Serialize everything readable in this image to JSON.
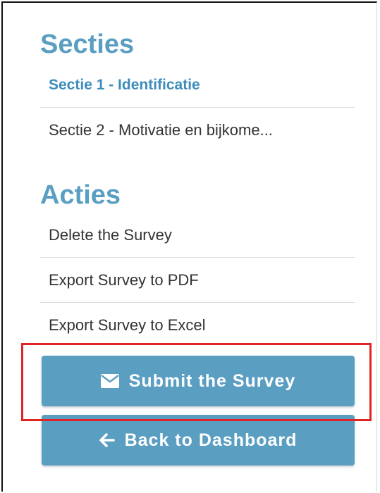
{
  "sections": {
    "heading": "Secties",
    "items": [
      {
        "label": "Sectie 1 - Identificatie",
        "active": true
      },
      {
        "label": "Sectie 2 - Motivatie en bijkome...",
        "active": false
      }
    ]
  },
  "actions": {
    "heading": "Acties",
    "items": [
      {
        "label": "Delete the Survey"
      },
      {
        "label": "Export Survey to PDF"
      },
      {
        "label": "Export Survey to Excel"
      }
    ]
  },
  "buttons": {
    "submit_label": "Submit the Survey",
    "submit_icon": "envelope-icon",
    "back_label": "Back to Dashboard",
    "back_icon": "arrow-left-icon"
  },
  "colors": {
    "accent": "#5a9ec2",
    "active_link": "#3d8cbb",
    "highlight": "#e02424"
  }
}
